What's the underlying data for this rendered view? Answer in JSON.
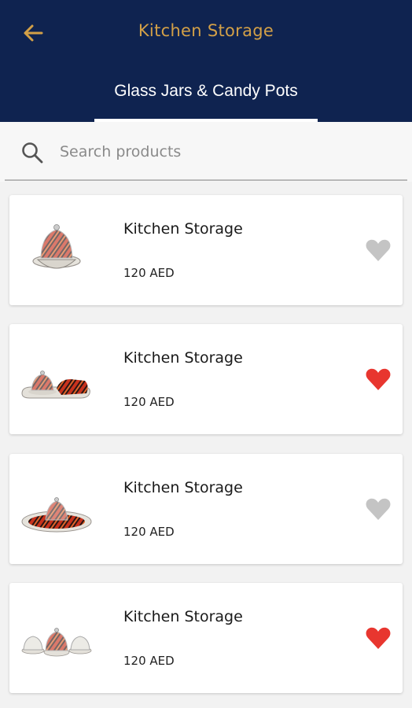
{
  "header": {
    "title": "Kitchen Storage",
    "back_icon": "arrow-left-icon",
    "accent_color": "#d3a047",
    "background_color": "#0f2350"
  },
  "tabs": [
    {
      "label": "Glass Jars & Candy Pots",
      "selected": true
    }
  ],
  "search": {
    "placeholder": "Search products",
    "value": "",
    "icon": "search-icon"
  },
  "products": [
    {
      "name": "Kitchen Storage",
      "price": "120 AED",
      "favorite": false,
      "image": "single-dome-candy-pot"
    },
    {
      "name": "Kitchen Storage",
      "price": "120 AED",
      "favorite": true,
      "image": "dome-jar-with-tray"
    },
    {
      "name": "Kitchen Storage",
      "price": "120 AED",
      "favorite": false,
      "image": "round-platter-with-dome"
    },
    {
      "name": "Kitchen Storage",
      "price": "120 AED",
      "favorite": true,
      "image": "triple-candy-pot-set"
    }
  ],
  "colors": {
    "favorite_on": "#e8362f",
    "favorite_off": "#c4c4c4"
  }
}
